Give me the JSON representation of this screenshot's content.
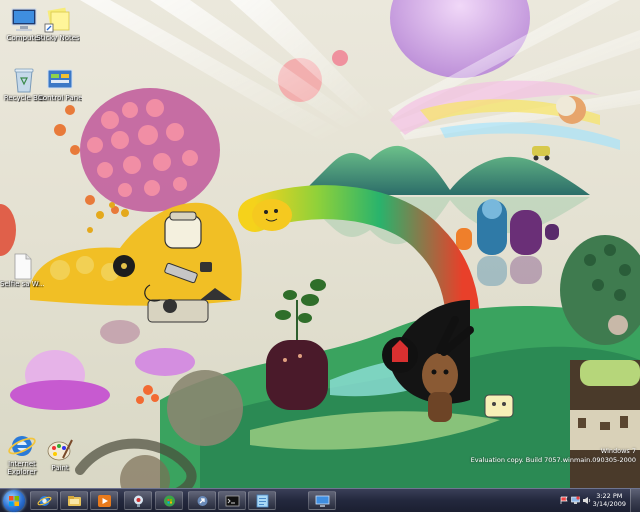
{
  "desktop": {
    "icons": [
      {
        "label": "Computer",
        "icon": "computer-icon"
      },
      {
        "label": "Sticky Notes",
        "icon": "sticky-notes-icon"
      },
      {
        "label": "Recycle Bin",
        "icon": "recycle-bin-icon"
      },
      {
        "label": "Control Panel",
        "icon": "control-panel-icon"
      },
      {
        "label": "Selfie sa W...",
        "icon": "document-icon"
      },
      {
        "label": "Internet Explorer",
        "icon": "internet-explorer-icon"
      },
      {
        "label": "Paint",
        "icon": "paint-icon"
      }
    ]
  },
  "watermark": {
    "line1": "Windows 7",
    "line2": "Evaluation copy. Build 7057.winmain.090305-2000"
  },
  "taskbar": {
    "buttons": [
      {
        "icon": "internet-explorer-icon"
      },
      {
        "icon": "windows-explorer-icon"
      },
      {
        "icon": "media-player-icon"
      },
      {
        "icon": "network-icon"
      },
      {
        "icon": "media-center-icon"
      },
      {
        "icon": "shortcut-icon"
      },
      {
        "icon": "command-prompt-icon"
      },
      {
        "icon": "notepad-icon"
      },
      {
        "icon": "remote-desktop-icon"
      }
    ],
    "clock": {
      "time": "3:22 PM",
      "date": "3/14/2009"
    },
    "colors": {
      "start_orb": "#2a6ed1",
      "bar": "#23283d"
    }
  }
}
